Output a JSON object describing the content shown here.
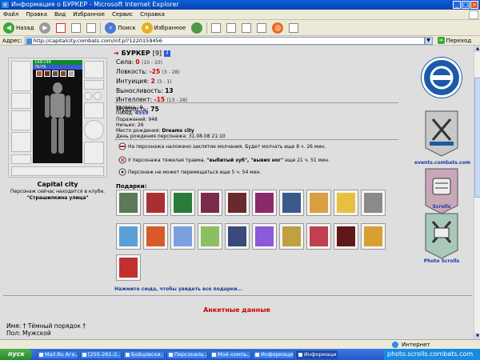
{
  "window": {
    "title": "Информация о БУРКЕР - Microsoft Internet Explorer"
  },
  "menu": [
    "Файл",
    "Правка",
    "Вид",
    "Избранное",
    "Сервис",
    "Справка"
  ],
  "toolbar": {
    "back": "Назад",
    "search": "Поиск",
    "favorites": "Избранное"
  },
  "address": {
    "label": "Адрес:",
    "url": "http://capitalcity.combats.com/inf.pl?1220159456",
    "go": "Переход"
  },
  "character": {
    "name": "БУРКЕР",
    "level": "[9]",
    "hp": "198/198",
    "mp": "76/76",
    "city": "Capital city",
    "location_text": "Персонаж сейчас находится в клубе.",
    "location_place": "\"Страшилкина улица\""
  },
  "stats": [
    {
      "label": "Сила:",
      "value": "0",
      "detail": "(10 - 10)",
      "red": true
    },
    {
      "label": "Ловкость:",
      "value": "-25",
      "detail": "(3 - 28)",
      "red": true
    },
    {
      "label": "Интуиция:",
      "value": "2",
      "detail": "(3 - 1)",
      "red": true
    },
    {
      "label": "Выносливость:",
      "value": "13",
      "detail": "",
      "red": false
    },
    {
      "label": "Интеллект:",
      "value": "-15",
      "detail": "(13 - 28)",
      "red": true
    },
    {
      "label": "Мудрость:",
      "value": "75",
      "detail": "",
      "red": false
    }
  ],
  "bio": {
    "level": "Уровень: 9",
    "wins_label": "Побед:",
    "wins": "4559",
    "losses": "Поражений: 948",
    "draws": "Ничьих: 26",
    "birthplace_label": "Место рождения:",
    "birthplace": "Dreams city",
    "birthday": "День рождения персонажа: 31.08.08 21:10"
  },
  "status": {
    "silence": "На персонажа наложено заклятие молчания. Будет молчать еще 8 ч. 26 мин.",
    "trauma_pre": "У персонажа тяжелая травма,",
    "trauma_name": "\"выбитый зуб\", \"вывих ног\"",
    "trauma_post": "еще 21 ч. 51 мин.",
    "immobile": "Персонаж не может перемещаться еще 5 ч. 54 мин."
  },
  "gifts": {
    "label": "Подарки:",
    "more_link": "Нажмите сюда, чтобы увидеть все подарки...",
    "row1": [
      "#5a7a5a",
      "#a83030",
      "#2a7a3a",
      "#7a2a4a",
      "#6a2a2a",
      "#8a2a6a",
      "#3a5a8a",
      "#d8a040",
      "#e8c040",
      "#8a8a8a"
    ],
    "row2": [
      "#5aa0d8",
      "#d85a2a",
      "#7aa0e0",
      "#8ac060",
      "#3a4a7a",
      "#8a5ad8",
      "#c0a040",
      "#c04050",
      "#601818",
      "#d8a030",
      "#c03030"
    ]
  },
  "sidebar": [
    {
      "label": "events.combats.com",
      "color": "#1a5aa8"
    },
    {
      "label": "Scrolls",
      "color": "#8a3a5a"
    },
    {
      "label": "Photo Scrolls",
      "color": "#3a7a5a"
    }
  ],
  "profile": {
    "header": "Анкетные данные",
    "name_label": "Имя:",
    "name_value": "† Тёмный порядок †",
    "gender_label": "Пол:",
    "gender_value": "Мужской"
  },
  "statusbar": {
    "zone": "Интернет"
  },
  "taskbar": {
    "start": "пуск",
    "items": [
      "Mail.Ru Аге...",
      "[255-261-2...",
      "Бойцовски...",
      "Персональ...",
      "Мой компь...",
      "Информаци...",
      "Информаци..."
    ],
    "tray_text": "photo.scrolls.combats.com"
  }
}
